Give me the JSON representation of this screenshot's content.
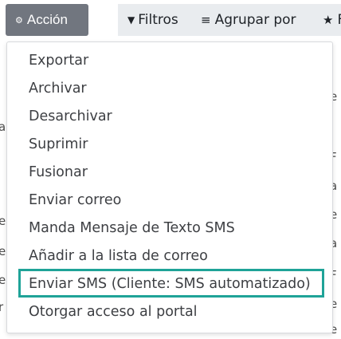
{
  "toolbar": {
    "action_label": "Acción",
    "filters_label": "Filtros",
    "group_by_label": "Agrupar por",
    "favorites_label": "F"
  },
  "action_menu": {
    "items": [
      {
        "label": "Exportar"
      },
      {
        "label": "Archivar"
      },
      {
        "label": "Desarchivar"
      },
      {
        "label": "Suprimir"
      },
      {
        "label": "Fusionar"
      },
      {
        "label": "Enviar correo"
      },
      {
        "label": "Manda Mensaje de Texto SMS"
      },
      {
        "label": "Añadir a la lista de correo"
      },
      {
        "label": "Enviar SMS (Cliente: SMS automatizado)",
        "highlighted": true
      },
      {
        "label": "Otorgar acceso al portal"
      }
    ],
    "highlight_color": "#1fa398"
  },
  "background_fragments": {
    "right": [
      "i",
      "e",
      "F",
      "a",
      "e",
      "a",
      "F",
      "e",
      "e",
      "F",
      "Fre"
    ],
    "left": [
      "a",
      "e",
      "e",
      "e",
      "r",
      "r"
    ]
  },
  "colors": {
    "action_button": "#71767f",
    "toolbar_button": "#e9ecef",
    "menu_text": "#3d3f43"
  }
}
